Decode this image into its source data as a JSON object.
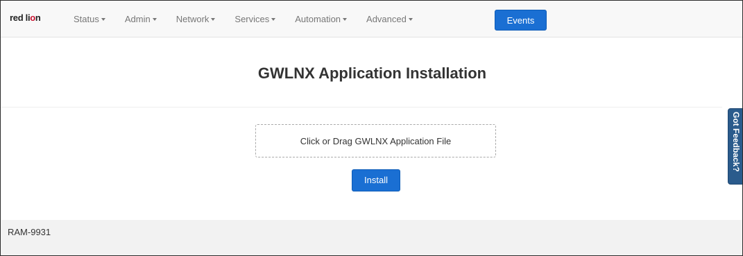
{
  "navbar": {
    "logo_text_1": "red li",
    "logo_text_2": "o",
    "logo_text_3": "n",
    "items": [
      {
        "label": "Status"
      },
      {
        "label": "Admin"
      },
      {
        "label": "Network"
      },
      {
        "label": "Services"
      },
      {
        "label": "Automation"
      },
      {
        "label": "Advanced"
      }
    ],
    "events_label": "Events"
  },
  "main": {
    "title": "GWLNX Application Installation",
    "dropzone_text": "Click or Drag GWLNX Application File",
    "install_label": "Install"
  },
  "feedback": {
    "label": "Got Feedback?"
  },
  "footer": {
    "device_name": "RAM-9931"
  },
  "colors": {
    "primary": "#1a6fd3",
    "feedback": "#2a5b8c",
    "logo_accent": "#c8102e"
  }
}
